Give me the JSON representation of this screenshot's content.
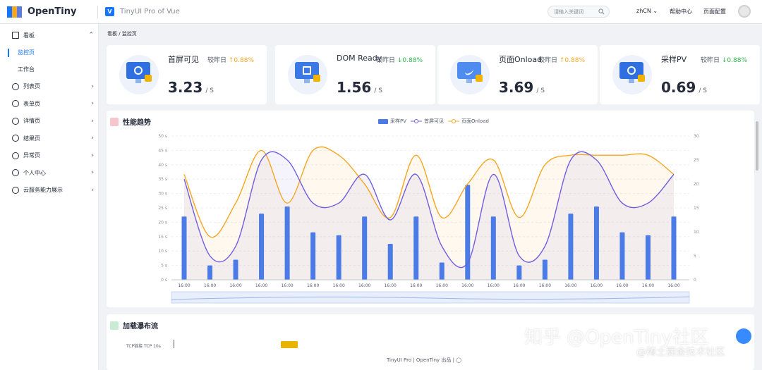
{
  "header": {
    "brand": "OpenTiny",
    "product": "TinyUI Pro of Vue",
    "search_placeholder": "请输入关键词",
    "lang": "zhCN",
    "help": "帮助中心",
    "page_config": "页面配置"
  },
  "sidebar": {
    "items": [
      {
        "label": "看板",
        "expanded": true,
        "children": [
          {
            "label": "监控页",
            "active": true
          },
          {
            "label": "工作台",
            "active": false
          }
        ]
      },
      {
        "label": "列表页"
      },
      {
        "label": "表单页"
      },
      {
        "label": "详情页"
      },
      {
        "label": "结果页"
      },
      {
        "label": "异常页"
      },
      {
        "label": "个人中心"
      },
      {
        "label": "云服务能力展示"
      }
    ]
  },
  "breadcrumb": [
    "看板",
    "监控页"
  ],
  "cards": [
    {
      "name": "首屏可见",
      "compare": "较昨日",
      "trend": "up",
      "change": "0.88%",
      "value": "3.23",
      "unit": "/ S"
    },
    {
      "name": "DOM Ready",
      "compare": "较昨日",
      "trend": "down",
      "change": "0.88%",
      "value": "1.56",
      "unit": "/ S"
    },
    {
      "name": "页面Onload",
      "compare": "较昨日",
      "trend": "up",
      "change": "0.88%",
      "value": "3.69",
      "unit": "/ S"
    },
    {
      "name": "采样PV",
      "compare": "较昨日",
      "trend": "down",
      "change": "0.88%",
      "value": "0.69",
      "unit": "/ S"
    }
  ],
  "perf": {
    "title": "性能趋势",
    "legend": [
      "采样PV",
      "首屏可见",
      "页面Onload"
    ]
  },
  "chart_data": {
    "type": "bar",
    "title": "性能趋势",
    "categories": [
      "16:00",
      "16:00",
      "16:00",
      "16:00",
      "16:00",
      "16:00",
      "16:00",
      "16:00",
      "16:00",
      "16:00",
      "16:00",
      "16:00",
      "16:00",
      "16:00",
      "16:00",
      "16:00",
      "16:00",
      "16:00",
      "16:00",
      "16:00"
    ],
    "left_axis": {
      "ticks": [
        "0 s",
        "5 s",
        "10 s",
        "15 s",
        "20 s",
        "25 s",
        "30 s",
        "35 s",
        "40 s",
        "45 s",
        "50 s"
      ],
      "ylim": [
        0,
        50
      ]
    },
    "right_axis": {
      "ticks": [
        "0",
        "5",
        "10",
        "15",
        "20",
        "25",
        "30"
      ],
      "ylim": [
        0,
        30
      ]
    },
    "series": [
      {
        "name": "采样PV",
        "type": "bar",
        "axis": "left",
        "values": [
          22,
          5,
          7,
          23,
          25.5,
          16.5,
          15.5,
          22,
          12.5,
          22,
          6,
          33,
          22,
          5,
          7,
          23,
          25.5,
          16.5,
          15.5,
          22
        ]
      },
      {
        "name": "首屏可见",
        "type": "line",
        "axis": "right",
        "values": [
          21,
          5,
          7,
          25,
          25,
          16,
          16,
          22,
          12.5,
          22,
          7,
          3.5,
          22,
          5,
          7,
          25,
          25,
          16,
          16,
          22
        ]
      },
      {
        "name": "页面Onload",
        "type": "line",
        "axis": "right",
        "values": [
          22,
          9,
          16,
          27,
          16,
          27,
          26,
          20,
          13,
          26,
          13,
          20,
          25,
          13,
          24,
          26,
          26,
          26,
          26,
          22
        ]
      }
    ],
    "colors": {
      "bar": "#4a7be6",
      "line1": "#6f5ee0",
      "line2": "#f5a623"
    },
    "grid": true,
    "legend": "top-center"
  },
  "waterfall": {
    "title": "加载瀑布流",
    "row_label": "TCP链接",
    "row_tag": "TCP",
    "row_time": "10s"
  },
  "footer": {
    "text1": "TinyUI Pro",
    "text2": "OpenTiny 出品"
  },
  "watermark": {
    "line1": "知乎 @OpenTiny社区",
    "line2": "@稀土掘金技术社区"
  }
}
